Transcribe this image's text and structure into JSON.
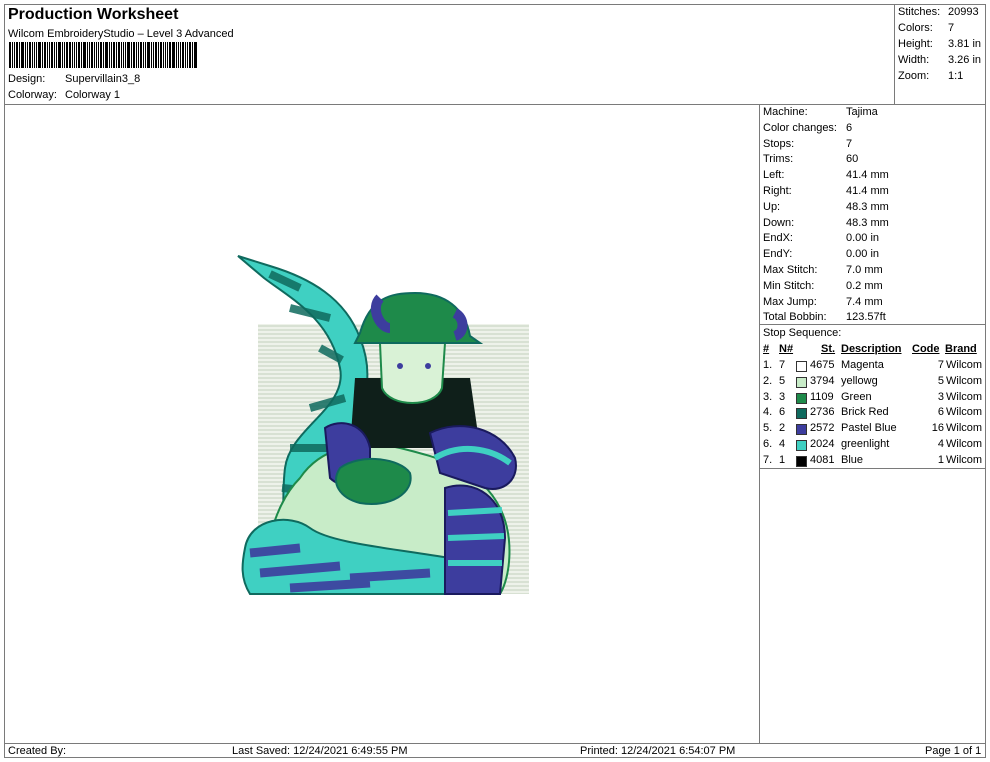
{
  "header": {
    "title": "Production Worksheet",
    "software": "Wilcom EmbroideryStudio – Level 3 Advanced",
    "design_label": "Design:",
    "design_value": "Supervillain3_8",
    "colorway_label": "Colorway:",
    "colorway_value": "Colorway 1"
  },
  "summary": [
    {
      "label": "Stitches:",
      "value": "20993"
    },
    {
      "label": "Colors:",
      "value": "7"
    },
    {
      "label": "Height:",
      "value": "3.81 in"
    },
    {
      "label": "Width:",
      "value": "3.26 in"
    },
    {
      "label": "Zoom:",
      "value": "1:1"
    }
  ],
  "machine_info": [
    {
      "label": "Machine:",
      "value": "Tajima"
    },
    {
      "label": "Color changes:",
      "value": "6"
    },
    {
      "label": "Stops:",
      "value": "7"
    },
    {
      "label": "Trims:",
      "value": "60"
    },
    {
      "label": "Left:",
      "value": "41.4 mm"
    },
    {
      "label": "Right:",
      "value": "41.4 mm"
    },
    {
      "label": "Up:",
      "value": "48.3 mm"
    },
    {
      "label": "Down:",
      "value": "48.3 mm"
    },
    {
      "label": "EndX:",
      "value": "0.00 in"
    },
    {
      "label": "EndY:",
      "value": "0.00 in"
    },
    {
      "label": "Max Stitch:",
      "value": "7.0 mm"
    },
    {
      "label": "Min Stitch:",
      "value": "0.2 mm"
    },
    {
      "label": "Max Jump:",
      "value": "7.4 mm"
    },
    {
      "label": "Total Bobbin:",
      "value": "123.57ft"
    }
  ],
  "stop_sequence": {
    "title": "Stop Sequence:",
    "headers": {
      "index": "#",
      "needle": "N#",
      "stitches": "St.",
      "description": "Description",
      "code": "Code",
      "brand": "Brand"
    },
    "rows": [
      {
        "index": "1.",
        "needle": "7",
        "color": "#ffffff",
        "stitches": "4675",
        "description": "Magenta",
        "code": "7",
        "brand": "Wilcom"
      },
      {
        "index": "2.",
        "needle": "5",
        "color": "#c8ecc8",
        "stitches": "3794",
        "description": "yellowg",
        "code": "5",
        "brand": "Wilcom"
      },
      {
        "index": "3.",
        "needle": "3",
        "color": "#1e8a4a",
        "stitches": "1109",
        "description": "Green",
        "code": "3",
        "brand": "Wilcom"
      },
      {
        "index": "4.",
        "needle": "6",
        "color": "#0f6a5e",
        "stitches": "2736",
        "description": "Brick Red",
        "code": "6",
        "brand": "Wilcom"
      },
      {
        "index": "5.",
        "needle": "2",
        "color": "#3d3d9e",
        "stitches": "2572",
        "description": "Pastel Blue",
        "code": "16",
        "brand": "Wilcom"
      },
      {
        "index": "6.",
        "needle": "4",
        "color": "#3fd0c2",
        "stitches": "2024",
        "description": "greenlight",
        "code": "4",
        "brand": "Wilcom"
      },
      {
        "index": "7.",
        "needle": "1",
        "color": "#000000",
        "stitches": "4081",
        "description": "Blue",
        "code": "1",
        "brand": "Wilcom"
      }
    ]
  },
  "footer": {
    "created_by": "Created By:",
    "last_saved": "Last Saved: 12/24/2021 6:49:55 PM",
    "printed": "Printed: 12/24/2021 6:54:07 PM",
    "page": "Page 1 of 1"
  },
  "artwork": {
    "background_color": "#d8e4d0",
    "thread_colors": [
      "#3fd0c2",
      "#3d3d9e",
      "#1e8a4a",
      "#0f6a5e",
      "#c8ecc8",
      "#000000"
    ]
  }
}
